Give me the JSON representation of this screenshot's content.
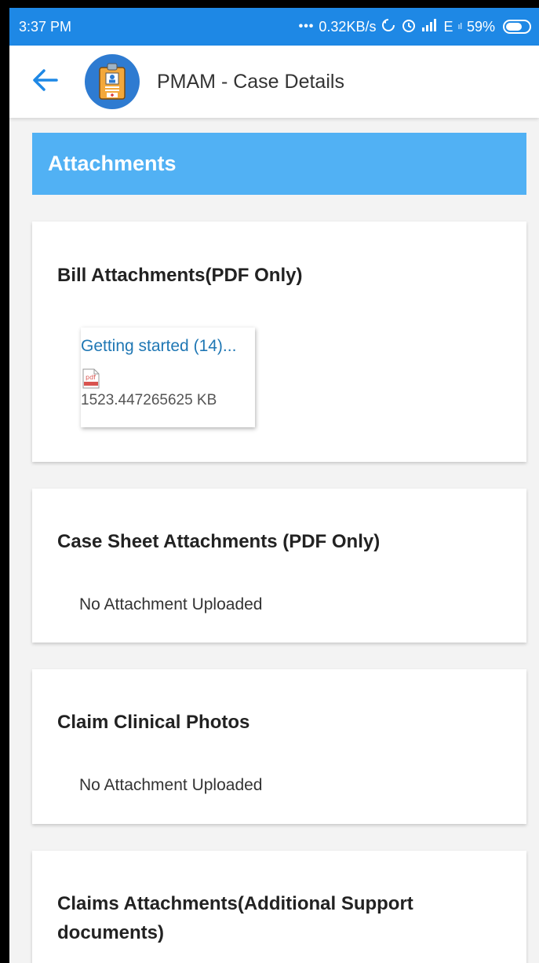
{
  "status_bar": {
    "time": "3:37 PM",
    "dots": "•••",
    "net_speed": "0.32KB/s",
    "network": "E",
    "network_sub": "ıl",
    "battery": "59%"
  },
  "app_bar": {
    "title": "PMAM - Case Details",
    "back_icon": "arrow-left-icon",
    "logo_icon": "id-badge-icon"
  },
  "section": {
    "title": "Attachments"
  },
  "cards": {
    "bill": {
      "title": "Bill Attachments(PDF Only)",
      "file_name": "Getting started (14)...",
      "file_icon": "pdf-file-icon",
      "file_icon_label": "pdf",
      "file_size": "1523.447265625 KB"
    },
    "case_sheet": {
      "title": "Case Sheet Attachments (PDF Only)",
      "empty": "No Attachment Uploaded"
    },
    "clinical_photos": {
      "title": "Claim Clinical Photos",
      "empty": "No Attachment Uploaded"
    },
    "claims": {
      "title": "Claims Attachments(Additional Support documents)"
    }
  },
  "colors": {
    "status_bar": "#1e88e5",
    "section_header": "#51b1f4",
    "link": "#1f77b4",
    "back_arrow": "#1e88e5"
  }
}
